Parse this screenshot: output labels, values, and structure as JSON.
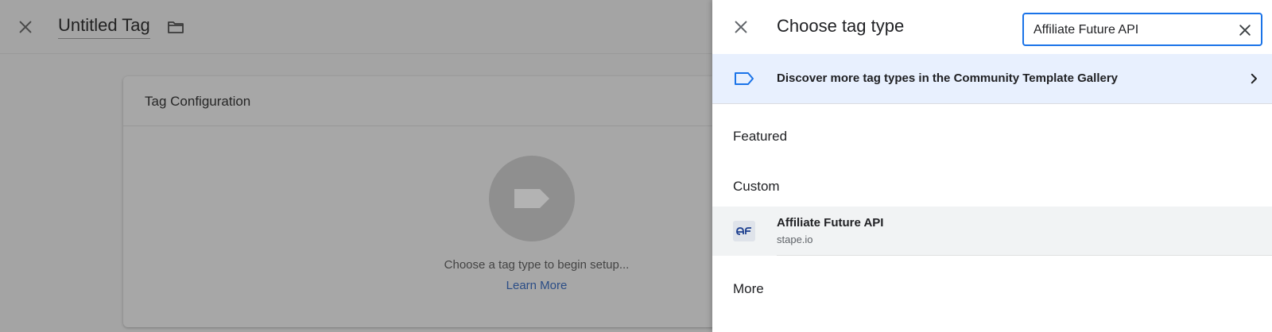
{
  "editor": {
    "tag_title": "Untitled Tag",
    "card_title": "Tag Configuration",
    "card_hint": "Choose a tag type to begin setup...",
    "card_link": "Learn More"
  },
  "panel": {
    "title": "Choose tag type",
    "search": {
      "value": "Affiliate Future API"
    },
    "discover_text": "Discover more tag types in the Community Template Gallery",
    "sections": {
      "featured": "Featured",
      "custom": "Custom",
      "more": "More"
    },
    "results": [
      {
        "name": "Affiliate Future API",
        "source": "stape.io"
      }
    ]
  },
  "colors": {
    "accent": "#1a73e8",
    "discover_bg": "#e8f0fe",
    "overlay_gray": "#a4a4a4"
  },
  "icons": [
    "close-icon",
    "folder-icon",
    "tag-icon",
    "chevron-right-icon",
    "affiliate-future-logo"
  ]
}
